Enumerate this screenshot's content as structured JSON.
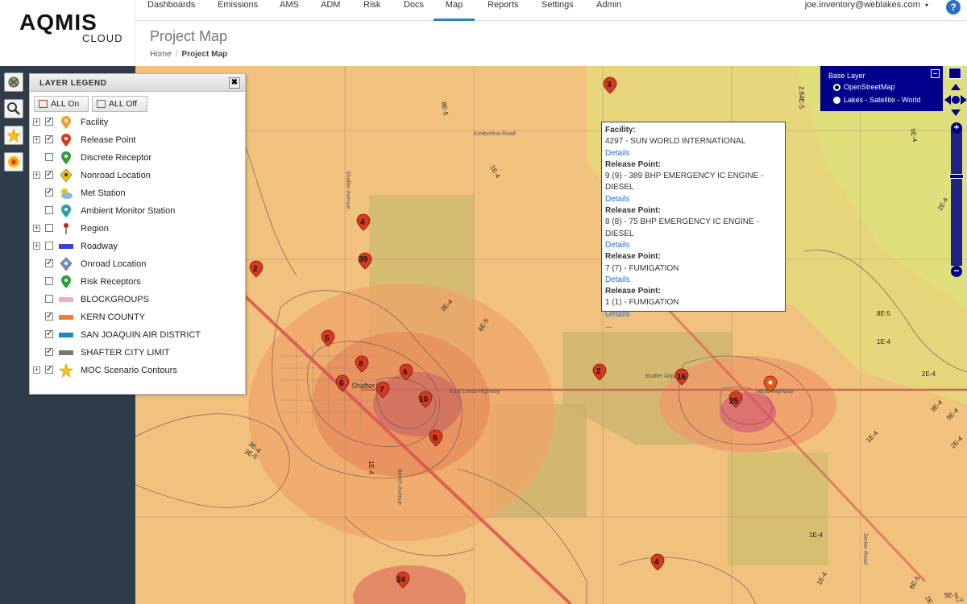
{
  "logo": {
    "main": "AQMIS",
    "sub": "CLOUD"
  },
  "nav": {
    "items": [
      {
        "label": "Dashboards",
        "active": false
      },
      {
        "label": "Emissions",
        "active": false
      },
      {
        "label": "AMS",
        "active": false
      },
      {
        "label": "ADM",
        "active": false
      },
      {
        "label": "Risk",
        "active": false
      },
      {
        "label": "Docs",
        "active": false
      },
      {
        "label": "Map",
        "active": true
      },
      {
        "label": "Reports",
        "active": false
      },
      {
        "label": "Settings",
        "active": false
      },
      {
        "label": "Admin",
        "active": false
      }
    ],
    "user": "joe.inventory@weblakes.com",
    "user_caret": "▾",
    "help": "?"
  },
  "page": {
    "title": "Project Map",
    "breadcrumb": {
      "home": "Home",
      "sep": "/",
      "current": "Project Map"
    }
  },
  "tools": [
    {
      "icon": "layers-icon"
    },
    {
      "icon": "search-icon"
    },
    {
      "icon": "contour-star-icon"
    },
    {
      "icon": "plume-icon"
    }
  ],
  "legend": {
    "title": "LAYER LEGEND",
    "close": "✖",
    "all_on": "ALL On",
    "all_off": "ALL Off",
    "items": [
      {
        "label": "Facility",
        "expand": true,
        "checked": true,
        "icon": "facility-pin-icon"
      },
      {
        "label": "Release Point",
        "expand": true,
        "checked": true,
        "icon": "release-point-pin-icon"
      },
      {
        "label": "Discrete Receptor",
        "expand": false,
        "checked": false,
        "icon": "discrete-receptor-pin-icon"
      },
      {
        "label": "Nonroad Location",
        "expand": true,
        "checked": true,
        "icon": "nonroad-diamond-icon"
      },
      {
        "label": "Met Station",
        "expand": false,
        "checked": true,
        "icon": "weather-cloud-icon"
      },
      {
        "label": "Ambient Monitor Station",
        "expand": false,
        "checked": false,
        "icon": "monitor-pin-icon"
      },
      {
        "label": "Region",
        "expand": true,
        "checked": false,
        "icon": "region-pushpin-icon"
      },
      {
        "label": "Roadway",
        "expand": true,
        "checked": false,
        "icon": "roadway-line-icon"
      },
      {
        "label": "Onroad Location",
        "expand": false,
        "checked": true,
        "icon": "onroad-diamond-icon"
      },
      {
        "label": "Risk Receptors",
        "expand": false,
        "checked": false,
        "icon": "risk-receptor-pin-icon"
      },
      {
        "label": "BLOCKGROUPS",
        "expand": false,
        "checked": false,
        "icon": "blockgroups-line-icon"
      },
      {
        "label": "KERN COUNTY",
        "expand": false,
        "checked": true,
        "icon": "kern-county-line-icon"
      },
      {
        "label": "SAN JOAQUIN AIR DISTRICT",
        "expand": false,
        "checked": true,
        "icon": "air-district-line-icon"
      },
      {
        "label": "SHAFTER CITY LIMIT",
        "expand": false,
        "checked": true,
        "icon": "city-limit-line-icon"
      },
      {
        "label": "MOC Scenario Contours",
        "expand": true,
        "checked": true,
        "icon": "contour-star-icon"
      }
    ],
    "colors": {
      "facility": "#f0a030",
      "release": "#d63a1e",
      "green": "#2e9e3a",
      "nonroad": "#f2c200",
      "monitor": "#2a9cb0",
      "roadway": "#3b3fd8",
      "onroad": "#6f93c9",
      "blockgroups": "#f5a8c8",
      "kern": "#f47c30",
      "airdistrict": "#1f87c7",
      "citylimit": "#777777"
    }
  },
  "popup": {
    "facility_label": "Facility:",
    "facility_value": "4297 - SUN WORLD INTERNATIONAL",
    "details": "Details",
    "release_label": "Release Point:",
    "releases": [
      "9 (9) - 389 BHP EMERGENCY IC ENGINE - DIESEL",
      "8 (8) - 75 BHP EMERGENCY IC ENGINE - DIESEL",
      "7 (7) - FUMIGATION",
      "1 (1) - FUMIGATION"
    ],
    "more": "..."
  },
  "baselayer": {
    "title": "Base Layer",
    "options": [
      {
        "label": "OpenStreetMap",
        "selected": true
      },
      {
        "label": "Lakes - Satellite - World",
        "selected": false
      }
    ]
  },
  "map": {
    "markers": [
      {
        "label": "3"
      },
      {
        "label": "4"
      },
      {
        "label": "39"
      },
      {
        "label": "2"
      },
      {
        "label": "5"
      },
      {
        "label": "8"
      },
      {
        "label": "6"
      },
      {
        "label": "6"
      },
      {
        "label": "7"
      },
      {
        "label": "10"
      },
      {
        "label": "8"
      },
      {
        "label": "2"
      },
      {
        "label": "16"
      },
      {
        "label": "25"
      },
      {
        "label": "4"
      },
      {
        "label": "24"
      }
    ],
    "road_labels": [
      "Kimberlina Road",
      "East Lerdo Highway",
      "Lerdo Highway",
      "Shafter Avenue",
      "Beech Avenue",
      "Zerker Road",
      "Shafter Airport"
    ],
    "contour_labels": [
      "8E-5",
      "1E-4",
      "2.64E-5",
      "5E-4",
      "2E-4",
      "3E-4",
      "3E-4",
      "8E-5",
      "1E-4",
      "2E-4",
      "3E-4",
      "5E-4",
      "1E-4",
      "2E-4",
      "1E-4",
      "1E-4",
      "3E-5",
      "1E-4",
      "8E-5",
      "2E-4",
      "6E-5",
      "5E-5"
    ],
    "town": "Shafter",
    "attribution": "CA"
  }
}
